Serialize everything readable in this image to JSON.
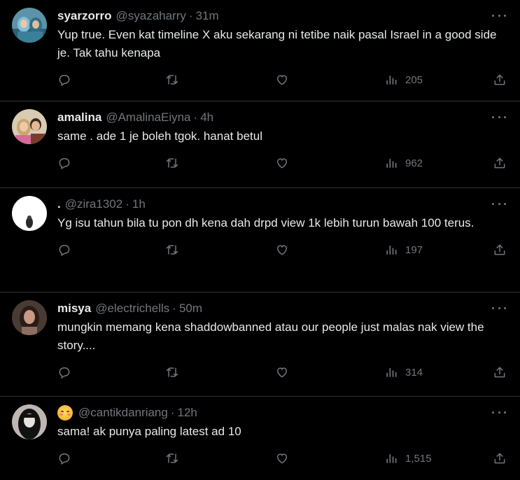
{
  "tweets": [
    {
      "name": "syarzorro",
      "handle": "@syazaharry",
      "time": "31m",
      "text": "Yup true. Even kat timeline X aku sekarang ni tetibe naik pasal Israel in a good side je. Tak tahu kenapa",
      "views": "205",
      "avatar_colors": [
        "#2b5f7a",
        "#7fc1d8"
      ]
    },
    {
      "name": "amalina",
      "handle": "@AmalinaEiyna",
      "time": "4h",
      "text": "same . ade 1 je boleh tgok. hanat betul",
      "views": "962",
      "avatar_colors": [
        "#c9b28a",
        "#f1c7a6"
      ]
    },
    {
      "name": ".",
      "handle": "@zira1302",
      "time": "1h",
      "text": "Yg isu tahun bila tu pon dh kena dah drpd view 1k lebih turun bawah 100 terus.",
      "views": "197",
      "avatar_colors": [
        "#ffffff",
        "#2a2a2a"
      ]
    },
    {
      "name": "misya",
      "handle": "@electrichells",
      "time": "50m",
      "text": "mungkin memang kena shaddowbanned atau our people just malas nak view the story....",
      "views": "314",
      "avatar_colors": [
        "#3a2a24",
        "#c89a84"
      ]
    },
    {
      "name": "",
      "name_emoji": "smiling-face-emoji",
      "handle": "@cantikdanriang",
      "time": "12h",
      "text": "sama! ak punya paling latest ad 10",
      "views": "1,515",
      "avatar_colors": [
        "#1a1a1a",
        "#e8e2de"
      ]
    }
  ],
  "separator": "·",
  "colors": {
    "background": "#000000",
    "text": "#e7e9ea",
    "muted": "#71767b",
    "border": "#2f3336"
  }
}
